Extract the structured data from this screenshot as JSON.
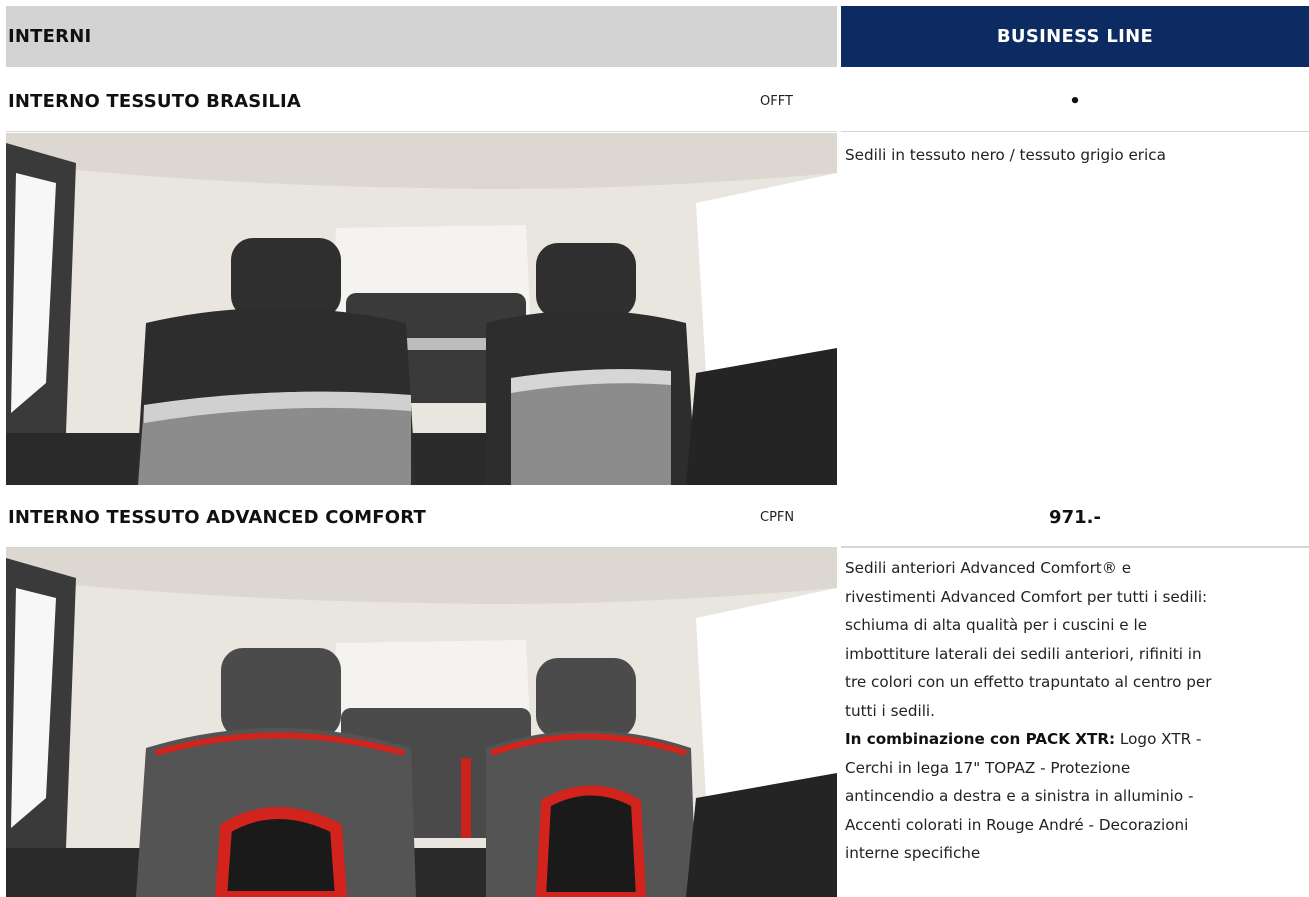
{
  "header": {
    "left_title": "INTERNI",
    "right_title": "BUSINESS LINE"
  },
  "items": [
    {
      "title": "INTERNO TESSUTO BRASILIA",
      "code": "OFFT",
      "price": "•",
      "description_lines": [
        "Sedili in tessuto nero / tessuto grigio erica"
      ]
    },
    {
      "title": "INTERNO TESSUTO ADVANCED COMFORT",
      "code": "CPFN",
      "price": "971.-",
      "description_lines": [
        "Sedili anteriori Advanced Comfort® e",
        "rivestimenti Advanced Comfort per tutti i sedili:",
        "schiuma di alta qualità per i cuscini e le",
        "imbottiture laterali dei sedili anteriori, rifiniti in",
        "tre colori con un effetto trapuntato al centro per",
        "tutti i sedili."
      ],
      "combo_label": "In combinazione con PACK XTR:",
      "combo_lines": [
        " Logo XTR -",
        "Cerchi in lega 17\" TOPAZ - Protezione",
        "antincendio a destra e a sinistra in alluminio -",
        "Accenti colorati in Rouge André - Decorazioni",
        "interne specifiche"
      ]
    }
  ],
  "colors": {
    "header_gray": "#d3d3d3",
    "header_navy": "#0c2b63",
    "accent_red": "#d3231d"
  }
}
